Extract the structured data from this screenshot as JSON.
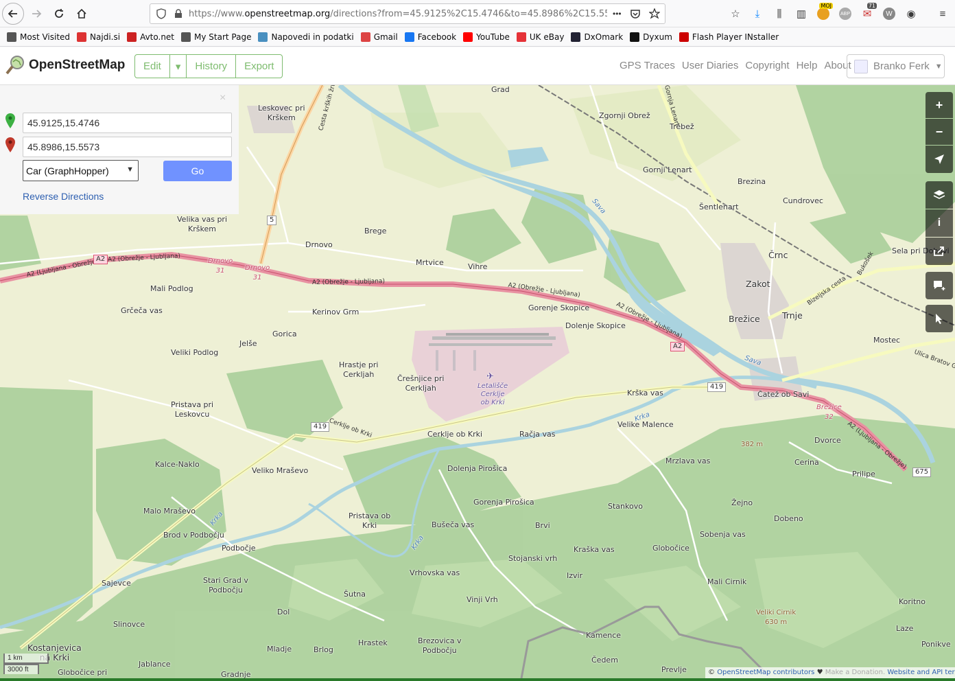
{
  "browser": {
    "url_prefix": "https://www.",
    "url_domain": "openstreetmap.org",
    "url_rest": "/directions?from=45.9125%2C15.4746&to=45.8986%2C15.5573",
    "more_dots": "•••",
    "ext_badge_moj": "MOJ",
    "ext_badge_count": "71",
    "ext_abp": "ABP"
  },
  "bookmarks": [
    {
      "label": "Most Visited",
      "icon": "gear-icon",
      "color": "#555"
    },
    {
      "label": "Najdi.si",
      "icon": "najdi-icon",
      "color": "#d33"
    },
    {
      "label": "Avto.net",
      "icon": "avto-icon",
      "color": "#c22"
    },
    {
      "label": "My Start Page",
      "icon": "globe-icon",
      "color": "#555"
    },
    {
      "label": "Napovedi in podatki",
      "icon": "weather-icon",
      "color": "#4a90c0"
    },
    {
      "label": "Gmail",
      "icon": "gmail-icon",
      "color": "#d44"
    },
    {
      "label": "Facebook",
      "icon": "facebook-icon",
      "color": "#1877f2"
    },
    {
      "label": "YouTube",
      "icon": "youtube-icon",
      "color": "#f00"
    },
    {
      "label": "UK eBay",
      "icon": "ebay-icon",
      "color": "#e53238"
    },
    {
      "label": "DxOmark",
      "icon": "dxomark-icon",
      "color": "#223"
    },
    {
      "label": "Dyxum",
      "icon": "dyxum-icon",
      "color": "#111"
    },
    {
      "label": "Flash Player INstaller",
      "icon": "flash-icon",
      "color": "#c00"
    }
  ],
  "osm": {
    "logo_text": "OpenStreetMap",
    "edit": "Edit",
    "history": "History",
    "export": "Export",
    "links": [
      "GPS Traces",
      "User Diaries",
      "Copyright",
      "Help",
      "About"
    ],
    "user": "Branko Ferk"
  },
  "directions": {
    "from": "45.9125,15.4746",
    "to": "45.8986,15.5573",
    "engine": "Car (GraphHopper)",
    "go": "Go",
    "reverse": "Reverse Directions",
    "close": "×"
  },
  "map": {
    "places": [
      {
        "t": "Grad"
      },
      {
        "t": "Leskovec pri\nKrškem"
      },
      {
        "t": "Zgornji Obrež"
      },
      {
        "t": "Trebež"
      },
      {
        "t": "Gornji Lenart"
      },
      {
        "t": "Brezina"
      },
      {
        "t": "Šentlenart"
      },
      {
        "t": "Cundrovec"
      },
      {
        "t": "Velika vas pri\nKrškem"
      },
      {
        "t": "Brege"
      },
      {
        "t": "Drnovo"
      },
      {
        "t": "Mrtvice"
      },
      {
        "t": "Vihre"
      },
      {
        "t": "Črnc"
      },
      {
        "t": "Sela pri Dobovi"
      },
      {
        "t": "Zakot"
      },
      {
        "t": "Mali Podlog"
      },
      {
        "t": "Gorenje Skopice"
      },
      {
        "t": "Brežice"
      },
      {
        "t": "Trnje"
      },
      {
        "t": "Grčeča vas"
      },
      {
        "t": "Kerinov Grm"
      },
      {
        "t": "Dolenje Skopice"
      },
      {
        "t": "Gorica"
      },
      {
        "t": "Mostec"
      },
      {
        "t": "Jelše"
      },
      {
        "t": "Veliki Podlog"
      },
      {
        "t": "Hrastje pri\nCerkljah"
      },
      {
        "t": "Črešnjice pri\nCerkljah"
      },
      {
        "t": "Krška vas"
      },
      {
        "t": "Čatež ob Savi"
      },
      {
        "t": "Pristava pri\nLeskovcu"
      },
      {
        "t": "Velike Malence"
      },
      {
        "t": "Cerklje ob Krki"
      },
      {
        "t": "Račja vas"
      },
      {
        "t": "Dvorce"
      },
      {
        "t": "Kalce-Naklo"
      },
      {
        "t": "Cerina"
      },
      {
        "t": "Veliko Mraševo"
      },
      {
        "t": "Dolenja Pirošica"
      },
      {
        "t": "Mrzlava vas"
      },
      {
        "t": "Prilipe"
      },
      {
        "t": "Žejno"
      },
      {
        "t": "Malo Mraševo"
      },
      {
        "t": "Gorenja Pirošica"
      },
      {
        "t": "Stankovo"
      },
      {
        "t": "Dobeno"
      },
      {
        "t": "Pristava ob\nKrki"
      },
      {
        "t": "Bušeča vas"
      },
      {
        "t": "Brvi"
      },
      {
        "t": "Sobenja vas"
      },
      {
        "t": "Brod v Podbočju"
      },
      {
        "t": "Podbočje"
      },
      {
        "t": "Kraška vas"
      },
      {
        "t": "Globočice"
      },
      {
        "t": "Stojanski vrh"
      },
      {
        "t": "Vrhovska vas"
      },
      {
        "t": "Izvir"
      },
      {
        "t": "Sajevce"
      },
      {
        "t": "Stari Grad v\nPodbočju"
      },
      {
        "t": "Mali Cirnik"
      },
      {
        "t": "Šutna"
      },
      {
        "t": "Vinji Vrh"
      },
      {
        "t": "Koritno"
      },
      {
        "t": "Dol"
      },
      {
        "t": "Slinovce"
      },
      {
        "t": "Laze"
      },
      {
        "t": "Kamence"
      },
      {
        "t": "Kostanjevica\nna Krki"
      },
      {
        "t": "Hrastek"
      },
      {
        "t": "Brezovica v\nPodbočju"
      },
      {
        "t": "Mladje"
      },
      {
        "t": "Brlog"
      },
      {
        "t": "Ponikve"
      },
      {
        "t": "Jablance"
      },
      {
        "t": "Čedem"
      },
      {
        "t": "Globočice pri"
      },
      {
        "t": "Gradnje"
      },
      {
        "t": "Prevlje"
      }
    ],
    "airport_label": "Letališče\nCerklje\nob Krki",
    "peaks": [
      "382 m",
      "Veliki Cirnik\n630 m"
    ],
    "rivers": [
      "Sava",
      "Sava",
      "Krka",
      "Krka",
      "Krka"
    ],
    "road_labels": [
      "A2 (Ljubljana - Obrežje)",
      "A2 (Obrežje - Ljubljana)",
      "A2 (Obrežje - Ljubljana)",
      "A2 (Obrežje - Ljubljana)",
      "A2 (Obrežje - Ljubljana)",
      "A2 (Ljubljana - Obrežje)",
      "Cesta krških žrtev",
      "Cerklje ob Krki",
      "Bizeljska cesta",
      "Bukošek",
      "Ulica Bratov Gerjovič",
      "Gornja Lenart"
    ],
    "exits": [
      "Drnovo\n31",
      "Drnovo\n31",
      "Brežice\n32"
    ],
    "shields": [
      "A2",
      "A2",
      "5",
      "419",
      "419",
      "675"
    ],
    "scale_km": "1 km",
    "scale_ft": "3000 ft"
  },
  "attribution": {
    "copy": "©",
    "osm_contrib": "OpenStreetMap contributors",
    "heart": "♥",
    "donate": "Make a Donation.",
    "terms": "Website and API terms"
  }
}
